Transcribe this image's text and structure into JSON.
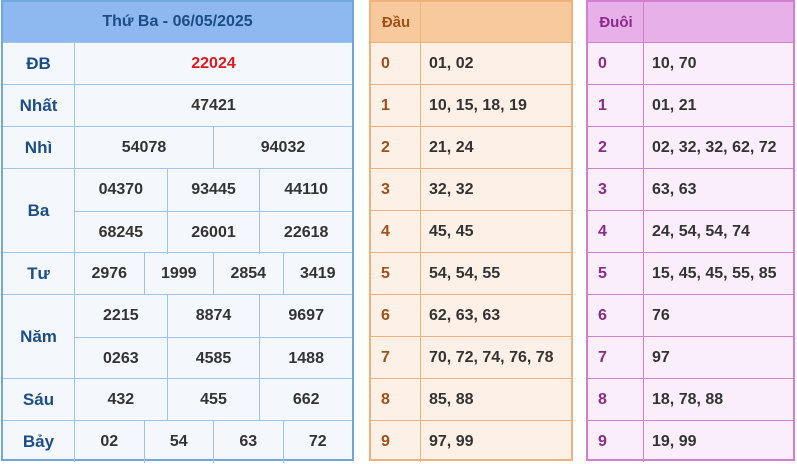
{
  "results": {
    "header": "Thứ Ba - 06/05/2025",
    "rows": [
      {
        "label": "ĐB",
        "lines": [
          [
            "22024"
          ]
        ],
        "special": true
      },
      {
        "label": "Nhất",
        "lines": [
          [
            "47421"
          ]
        ]
      },
      {
        "label": "Nhì",
        "lines": [
          [
            "54078",
            "94032"
          ]
        ]
      },
      {
        "label": "Ba",
        "lines": [
          [
            "04370",
            "93445",
            "44110"
          ],
          [
            "68245",
            "26001",
            "22618"
          ]
        ]
      },
      {
        "label": "Tư",
        "lines": [
          [
            "2976",
            "1999",
            "2854",
            "3419"
          ]
        ]
      },
      {
        "label": "Năm",
        "lines": [
          [
            "2215",
            "8874",
            "9697"
          ],
          [
            "0263",
            "4585",
            "1488"
          ]
        ]
      },
      {
        "label": "Sáu",
        "lines": [
          [
            "432",
            "455",
            "662"
          ]
        ]
      },
      {
        "label": "Bảy",
        "lines": [
          [
            "02",
            "54",
            "63",
            "72"
          ]
        ]
      }
    ]
  },
  "dau": {
    "title": "Đầu",
    "rows": [
      {
        "digit": "0",
        "values": "01, 02"
      },
      {
        "digit": "1",
        "values": "10, 15, 18, 19"
      },
      {
        "digit": "2",
        "values": "21, 24"
      },
      {
        "digit": "3",
        "values": "32, 32"
      },
      {
        "digit": "4",
        "values": "45, 45"
      },
      {
        "digit": "5",
        "values": "54, 54, 55"
      },
      {
        "digit": "6",
        "values": "62, 63, 63"
      },
      {
        "digit": "7",
        "values": "70, 72, 74, 76, 78"
      },
      {
        "digit": "8",
        "values": "85, 88"
      },
      {
        "digit": "9",
        "values": "97, 99"
      }
    ]
  },
  "duoi": {
    "title": "Đuôi",
    "rows": [
      {
        "digit": "0",
        "values": "10, 70"
      },
      {
        "digit": "1",
        "values": "01, 21"
      },
      {
        "digit": "2",
        "values": "02, 32, 32, 62, 72"
      },
      {
        "digit": "3",
        "values": "63, 63"
      },
      {
        "digit": "4",
        "values": "24, 54, 54, 74"
      },
      {
        "digit": "5",
        "values": "15, 45, 45, 55, 85"
      },
      {
        "digit": "6",
        "values": "76"
      },
      {
        "digit": "7",
        "values": "97"
      },
      {
        "digit": "8",
        "values": "18, 78, 88"
      },
      {
        "digit": "9",
        "values": "19, 99"
      }
    ]
  },
  "colors": {
    "special_prize": "#e0191e",
    "results_header": "#8db8f0",
    "dau_header": "#f9c99e",
    "duoi_header": "#e8b0e8"
  }
}
